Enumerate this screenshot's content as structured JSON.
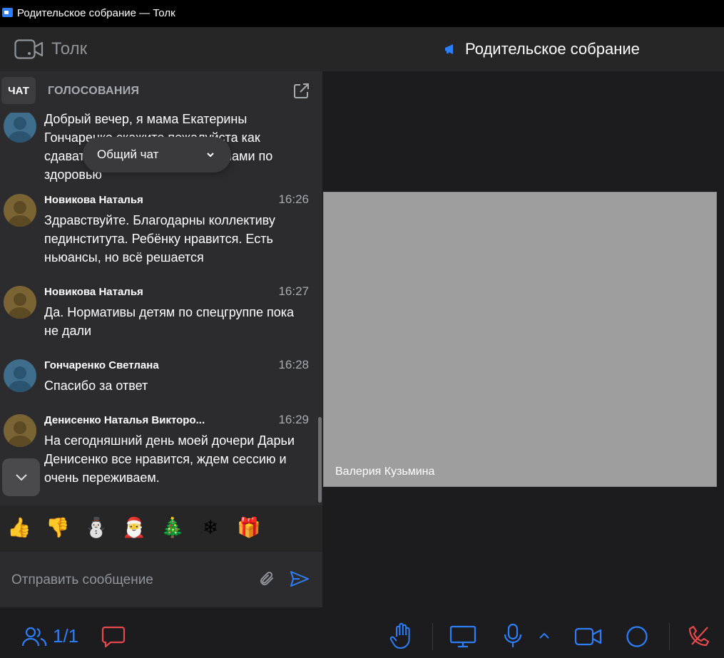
{
  "window": {
    "title": "Родительское собрание — Толк"
  },
  "header": {
    "brand": "Толк",
    "meeting_title": "Родительское собрание"
  },
  "chat": {
    "tabs": {
      "chat": "ЧАТ",
      "votes": "ГОЛОСОВАНИЯ"
    },
    "selector": "Общий чат",
    "messages": [
      {
        "author": "",
        "time": "",
        "text": "Добрый вечер, я мама Екатерины Гончаренко скажите пожалуйста как сдавать зачёт детям с проблемами по здоровью"
      },
      {
        "author": "Новикова Наталья",
        "time": "16:26",
        "text": "Здравствуйте. Благодарны коллективу пединститута. Ребёнку нравится. Есть ньюансы, но всё решается"
      },
      {
        "author": "Новикова Наталья",
        "time": "16:27",
        "text": "Да. Нормативы детям по спецгруппе пока не дали"
      },
      {
        "author": "Гончаренко Светлана",
        "time": "16:28",
        "text": "Спасибо за ответ"
      },
      {
        "author": "Денисенко Наталья Викторо...",
        "time": "16:29",
        "text": "На сегодняшний день моей дочери Дарьи Денисенко все нравится, ждем сессию и очень переживаем."
      }
    ],
    "reactions": [
      "👍",
      "👎",
      "⛄",
      "🎅",
      "🎄",
      "❄",
      "🎁"
    ],
    "composer": {
      "placeholder": "Отправить сообщение"
    }
  },
  "stage": {
    "participant_name": "Валерия Кузьмина"
  },
  "toolbar": {
    "participants": "1/1"
  },
  "colors": {
    "accent": "#2d7ff9",
    "hangup": "#e5484d"
  }
}
